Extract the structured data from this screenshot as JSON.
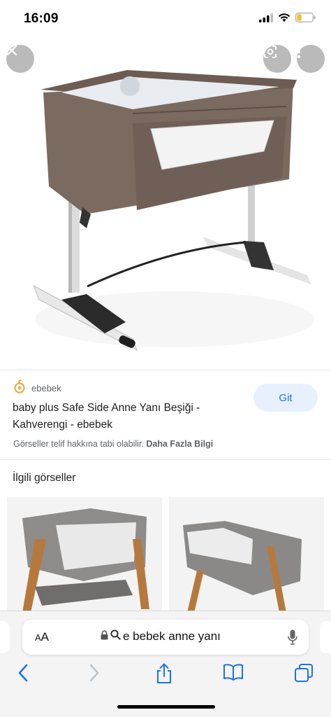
{
  "status_bar": {
    "time": "16:09",
    "icons": [
      "cellular-signal-icon",
      "wifi-icon",
      "battery-low-icon"
    ]
  },
  "viewer": {
    "close_icon": "close-icon",
    "lens_icon": "google-lens-icon",
    "more_icon": "more-vertical-icon"
  },
  "result": {
    "source": "ebebek",
    "title": "baby plus Safe Side Anne Yanı Beşiği - Kahverengi - ebebek",
    "go_button": "Git",
    "copyright_text": "Görseller telif hakkına tabi olabilir.",
    "more_info_link": "Daha Fazla Bilgi"
  },
  "related": {
    "heading": "İlgili görseller"
  },
  "safari": {
    "aa_label_big": "A",
    "aa_label_small": "A",
    "url_text": "e bebek anne yanı",
    "toolbar_icons": [
      "back-icon",
      "forward-icon",
      "share-icon",
      "bookmarks-icon",
      "tabs-icon"
    ]
  },
  "colors": {
    "accent": "#1a73e8",
    "button_bg": "#e8f0fe",
    "bed_brown": "#7b6a60",
    "battery_yellow": "#f2c230"
  }
}
